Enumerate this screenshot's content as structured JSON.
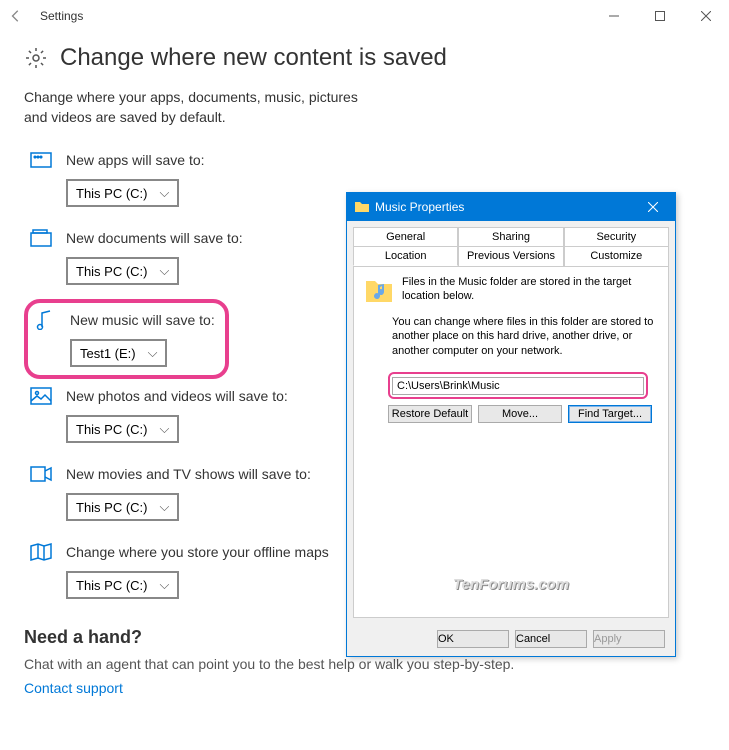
{
  "window": {
    "title": "Settings"
  },
  "page": {
    "title": "Change where new content is saved",
    "intro": "Change where your apps, documents, music, pictures and videos are saved by default."
  },
  "rows": {
    "apps": {
      "label": "New apps will save to:",
      "value": "This PC (C:)"
    },
    "docs": {
      "label": "New documents will save to:",
      "value": "This PC (C:)"
    },
    "music": {
      "label": "New music will save to:",
      "value": "Test1 (E:)"
    },
    "photos": {
      "label": "New photos and videos will save to:",
      "value": "This PC (C:)"
    },
    "movies": {
      "label": "New movies and TV shows will save to:",
      "value": "This PC (C:)"
    },
    "maps": {
      "label": "Change where you store your offline maps",
      "value": "This PC (C:)"
    }
  },
  "help": {
    "title": "Need a hand?",
    "text": "Chat with an agent that can point you to the best help or walk you step-by-step.",
    "link": "Contact support"
  },
  "dialog": {
    "title": "Music Properties",
    "tabs_row1": {
      "general": "General",
      "sharing": "Sharing",
      "security": "Security"
    },
    "tabs_row2": {
      "location": "Location",
      "prev": "Previous Versions",
      "customize": "Customize"
    },
    "header_text": "Files in the Music folder are stored in the target location below.",
    "desc": "You can change where files in this folder are stored to another place on this hard drive, another drive, or another computer on your network.",
    "path": "C:\\Users\\Brink\\Music",
    "buttons": {
      "restore": "Restore Default",
      "move": "Move...",
      "find": "Find Target..."
    },
    "footer": {
      "ok": "OK",
      "cancel": "Cancel",
      "apply": "Apply"
    }
  },
  "watermark": "TenForums.com"
}
